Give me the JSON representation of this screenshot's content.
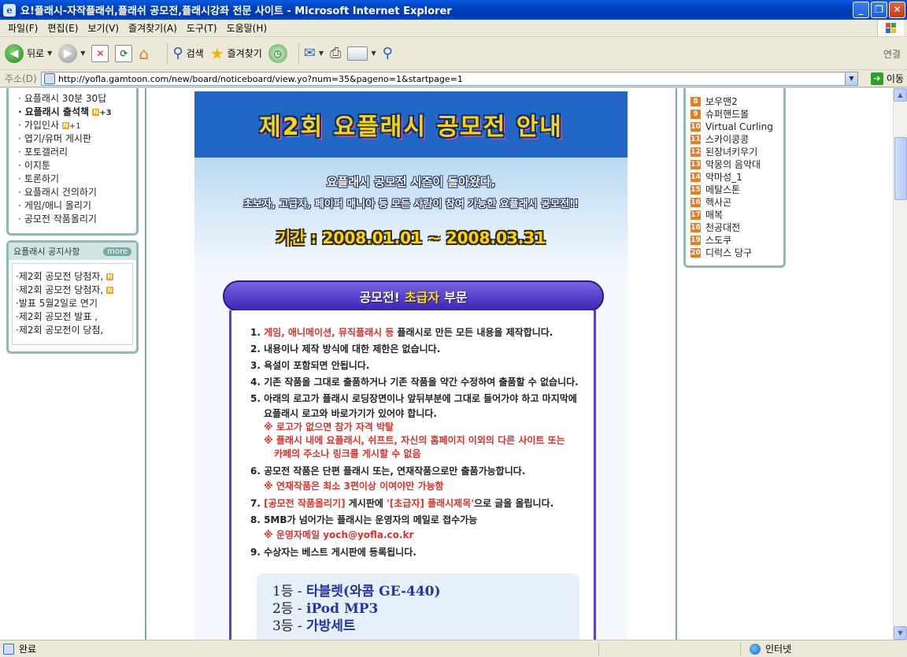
{
  "window": {
    "title": "요!플래시-자작플래쉬,플래쉬 공모전,플래시강좌 전문 사이트 - Microsoft Internet Explorer"
  },
  "menu": [
    "파일(F)",
    "편집(E)",
    "보기(V)",
    "즐겨찾기(A)",
    "도구(T)",
    "도움말(H)"
  ],
  "toolbar": {
    "back_label": "뒤로",
    "search_label": "검색",
    "favorites_label": "즐겨찾기",
    "links_label": "연결"
  },
  "address": {
    "label": "주소(D)",
    "url": "http://yofla.gamtoon.com/new/board/noticeboard/view.yo?num=35&pageno=1&startpage=1",
    "go_label": "이동"
  },
  "left_menu": {
    "items": [
      {
        "label": "요플래시 30분 30답",
        "bold": false
      },
      {
        "label": "요플래시 출석책",
        "bold": true,
        "badge": "+3"
      },
      {
        "label": "가입인사",
        "bold": false,
        "badge": "+1"
      },
      {
        "label": "엽기/유머 게시판",
        "bold": false
      },
      {
        "label": "포토갤러리",
        "bold": false
      },
      {
        "label": "이지툰",
        "bold": false
      },
      {
        "label": "토론하기",
        "bold": false
      },
      {
        "label": "요플래시 건의하기",
        "bold": false
      },
      {
        "label": "게임/애니 올리기",
        "bold": false
      },
      {
        "label": "공모전 작품올리기",
        "bold": false
      }
    ]
  },
  "notice_box": {
    "title": "요플래시 공지사항",
    "more_label": "more",
    "items": [
      {
        "label": "·제2회 공모전 당첨자,",
        "new": true
      },
      {
        "label": "·제2회 공모전 당첨자,",
        "new": true
      },
      {
        "label": "·발표 5월2일로 연기",
        "new": false
      },
      {
        "label": "·제2회 공모전 발표 ,",
        "new": false
      },
      {
        "label": "·제2회 공모전이 당첨,",
        "new": false
      }
    ]
  },
  "notice": {
    "banner": "제2회 요플래시 공모전 안내",
    "intro1": "요플래시 공모전 시즌이 돌아왔다,",
    "intro2": "초보자, 고급자, 페이퍼 매니아 등 모든 사람이 참여 가능한 요플래시 공모전!!",
    "period": "기간 : 2008.01.01 ~ 2008.03.31",
    "section_pre": "공모전!",
    "section_hl": "초급자",
    "section_post": "부문",
    "rules": {
      "r1_num": "1.",
      "r1_red": "게임, 애니메이션, 뮤직플래시 등",
      "r1_rest": " 플래시로 만든 모든 내용을 제작합니다.",
      "r2": "2. 내용이나 제작 방식에 대한 제한은 없습니다.",
      "r3": "3. 욕설이 포함되면 안됩니다.",
      "r4": "4. 기존 작품을 그대로 출품하거나 기존 작품을 약간 수정하여 출품할 수 없습니다.",
      "r5a": "5. 아래의 로고가 플래시 로딩장면이나 앞뒤부분에 그대로 들어가야 하고 마지막에",
      "r5b": "요플래시 로고와 바로가기가 있어야 합니다.",
      "n5a": "※ 로고가 없으면 참가 자격 박탈",
      "n5b": "※ 플래시 내에 요플래시, 쉬프트, 자신의 홈페이지 이외의 다른 사이트 또는",
      "n5c": "카페의 주소나 링크를 게시할 수 없음",
      "r6": "6. 공모전 작품은 단편 플래시 또는, 연재작품으로만 출품가능합니다.",
      "n6": "※ 연재작품은 최소 3편이상 이여야만 가능함",
      "r7_num": "7.",
      "r7_red1": "[공모전 작품올리기]",
      "r7_mid": " 게시판에 ",
      "r7_red2": "'[초급자] 플래시제목'",
      "r7_end": "으로 글을 올립니다.",
      "r8": "8. 5MB가 넘어가는 플래시는 운영자의 메일로 접수가능",
      "n8": "※ 운영자메일 yoch@yofla.co.kr",
      "r9": "9. 수상자는 베스트 게시판에 등록됩니다."
    },
    "prizes": [
      {
        "rank": "1등 - ",
        "prize": "타블렛(와콤 GE-440)"
      },
      {
        "rank": "2등 - ",
        "prize": "iPod MP3"
      },
      {
        "rank": "3등 - ",
        "prize": "가방세트"
      }
    ]
  },
  "ranking": {
    "items": [
      {
        "num": "8",
        "label": "보우맨2"
      },
      {
        "num": "9",
        "label": "슈퍼핸드볼"
      },
      {
        "num": "10",
        "label": "Virtual Curling"
      },
      {
        "num": "11",
        "label": "스카이콩콩"
      },
      {
        "num": "12",
        "label": "된장녀키우기"
      },
      {
        "num": "13",
        "label": "악몽의 음악대"
      },
      {
        "num": "14",
        "label": "악마성_1"
      },
      {
        "num": "15",
        "label": "메탈스톤"
      },
      {
        "num": "16",
        "label": "헥사곤"
      },
      {
        "num": "17",
        "label": "매복"
      },
      {
        "num": "18",
        "label": "천공대전"
      },
      {
        "num": "19",
        "label": "스도쿠"
      },
      {
        "num": "20",
        "label": "디럭스 당구"
      }
    ]
  },
  "status": {
    "text": "완료",
    "zone": "인터넷"
  }
}
